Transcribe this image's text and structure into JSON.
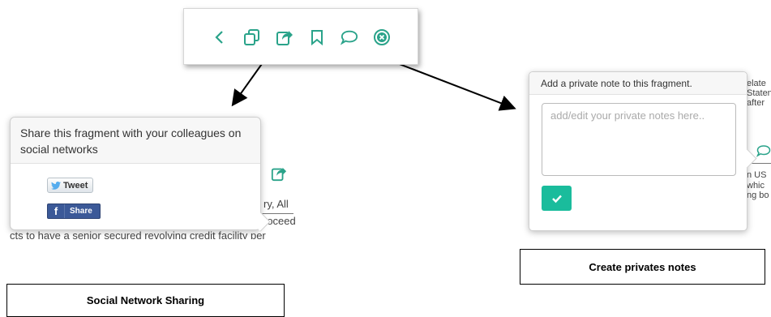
{
  "toolbar": {
    "icons": [
      "chevron-left-icon",
      "copy-icon",
      "share-icon",
      "bookmark-icon",
      "comment-icon",
      "close-circle-icon"
    ]
  },
  "share_popup": {
    "message": "Share this fragment with your colleagues on social networks",
    "tweet_label": "Tweet",
    "facebook_label": "Share",
    "background_lines": [
      "ry, All",
      "roceed",
      "cts to have a senior secured revolving credit facility per"
    ]
  },
  "note_popup": {
    "header": "Add a private note to this fragment.",
    "placeholder": "add/edit your private notes here..",
    "background_right": [
      "elate",
      "Staten",
      "after",
      "n US",
      "whic",
      "ng bo"
    ]
  },
  "captions": {
    "left": "Social Network Sharing",
    "right": "Create privates notes"
  },
  "colors": {
    "accent": "#1abc9c",
    "toolbar_icon": "#2aa38a",
    "twitter": "#55acee",
    "facebook": "#3b5998"
  }
}
